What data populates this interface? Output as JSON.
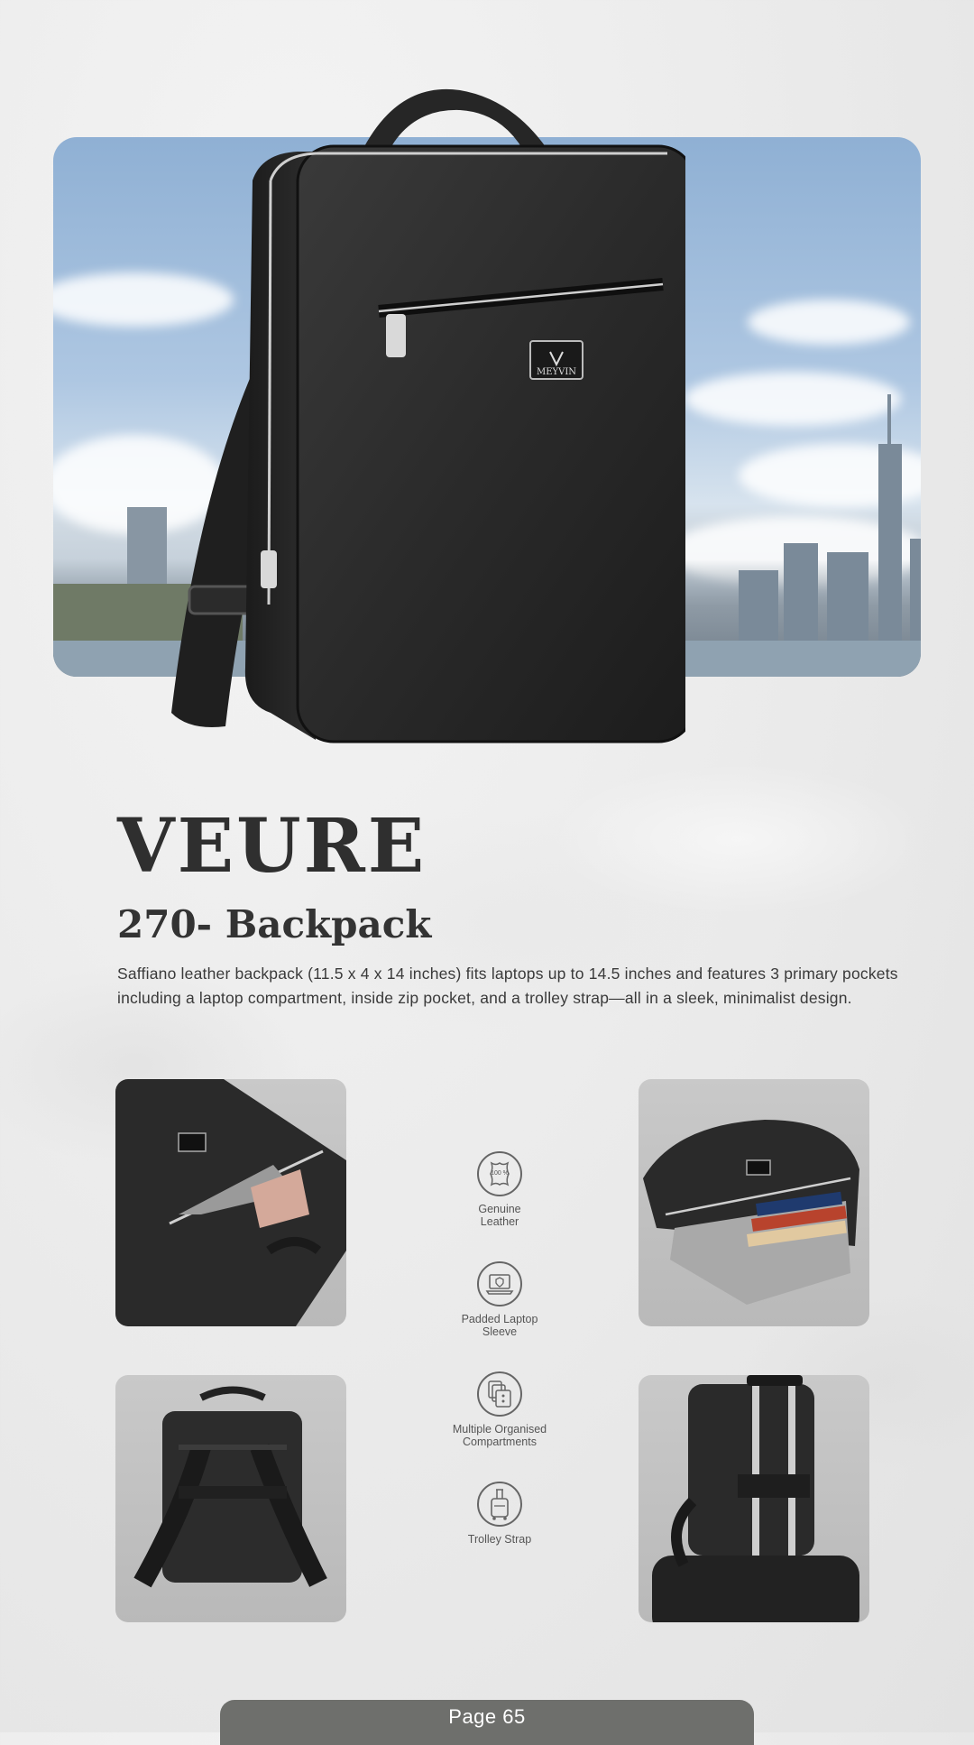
{
  "product": {
    "name": "VEURE",
    "model": "270- Backpack",
    "brand_logo_text": "MEYVIN",
    "description": "Saffiano leather backpack (11.5 x 4 x 14 inches) fits laptops up to 14.5 inches and features 3 primary pockets including a laptop compartment, inside zip pocket, and a trolley strap—all in a sleek, minimalist design."
  },
  "features": [
    {
      "label": "Genuine Leather",
      "icon": "leather-hide-icon",
      "badge": "100 %"
    },
    {
      "label": "Padded Laptop Sleeve",
      "icon": "laptop-shield-icon"
    },
    {
      "label": "Multiple Organised Compartments",
      "icon": "compartments-icon"
    },
    {
      "label": "Trolley Strap",
      "icon": "trolley-luggage-icon"
    }
  ],
  "footer": {
    "page_label": "Page 65"
  },
  "colors": {
    "footer_bg": "#6e6f6c",
    "title": "#2f2f2f",
    "bag": "#2a2a2a"
  }
}
